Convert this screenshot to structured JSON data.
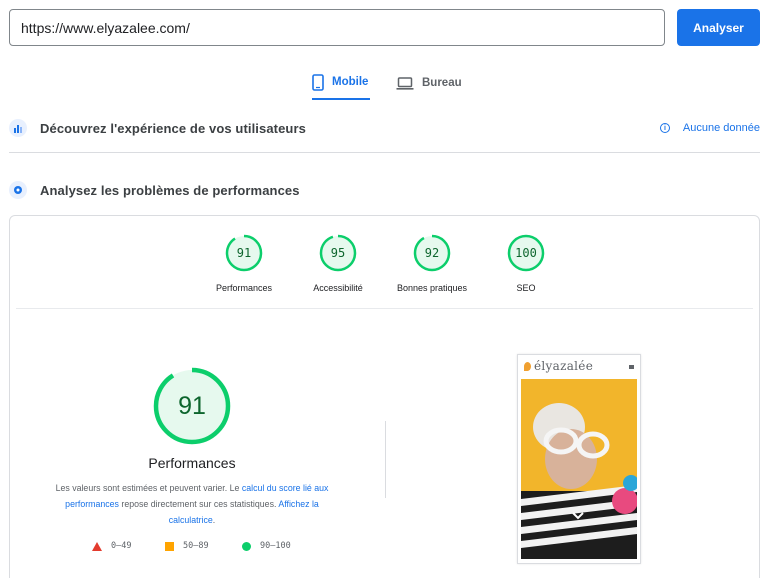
{
  "search": {
    "value": "https://www.elyazalee.com/"
  },
  "analyze_label": "Analyser",
  "tabs": [
    {
      "label": "Mobile",
      "active": true,
      "icon": "smartphone-icon"
    },
    {
      "label": "Bureau",
      "active": false,
      "icon": "laptop-icon"
    }
  ],
  "section_user": {
    "title": "Découvrez l'expérience de vos utilisateurs",
    "no_data": "Aucune donnée"
  },
  "section_perf": {
    "title": "Analysez les problèmes de performances"
  },
  "scores": [
    {
      "label": "Performances",
      "value": "91"
    },
    {
      "label": "Accessibilité",
      "value": "95"
    },
    {
      "label": "Bonnes pratiques",
      "value": "92"
    },
    {
      "label": "SEO",
      "value": "100"
    }
  ],
  "main_score": {
    "value": "91",
    "label": "Performances"
  },
  "description": {
    "part1": "Les valeurs sont estimées et peuvent varier. Le ",
    "link1": "calcul du score lié aux performances",
    "part2": " repose directement sur ces statistiques. ",
    "link2": "Affichez la calculatrice",
    "part3": "."
  },
  "legend": [
    {
      "range": "0–49",
      "color": "#e33b2e"
    },
    {
      "range": "50–89",
      "color": "#ffa400"
    },
    {
      "range": "90–100",
      "color": "#0cce6b"
    }
  ],
  "preview": {
    "brand": "élyazalée"
  },
  "colors": {
    "accent": "#1a73e8",
    "good": "#0cce6b",
    "good_text": "#0d652d"
  }
}
